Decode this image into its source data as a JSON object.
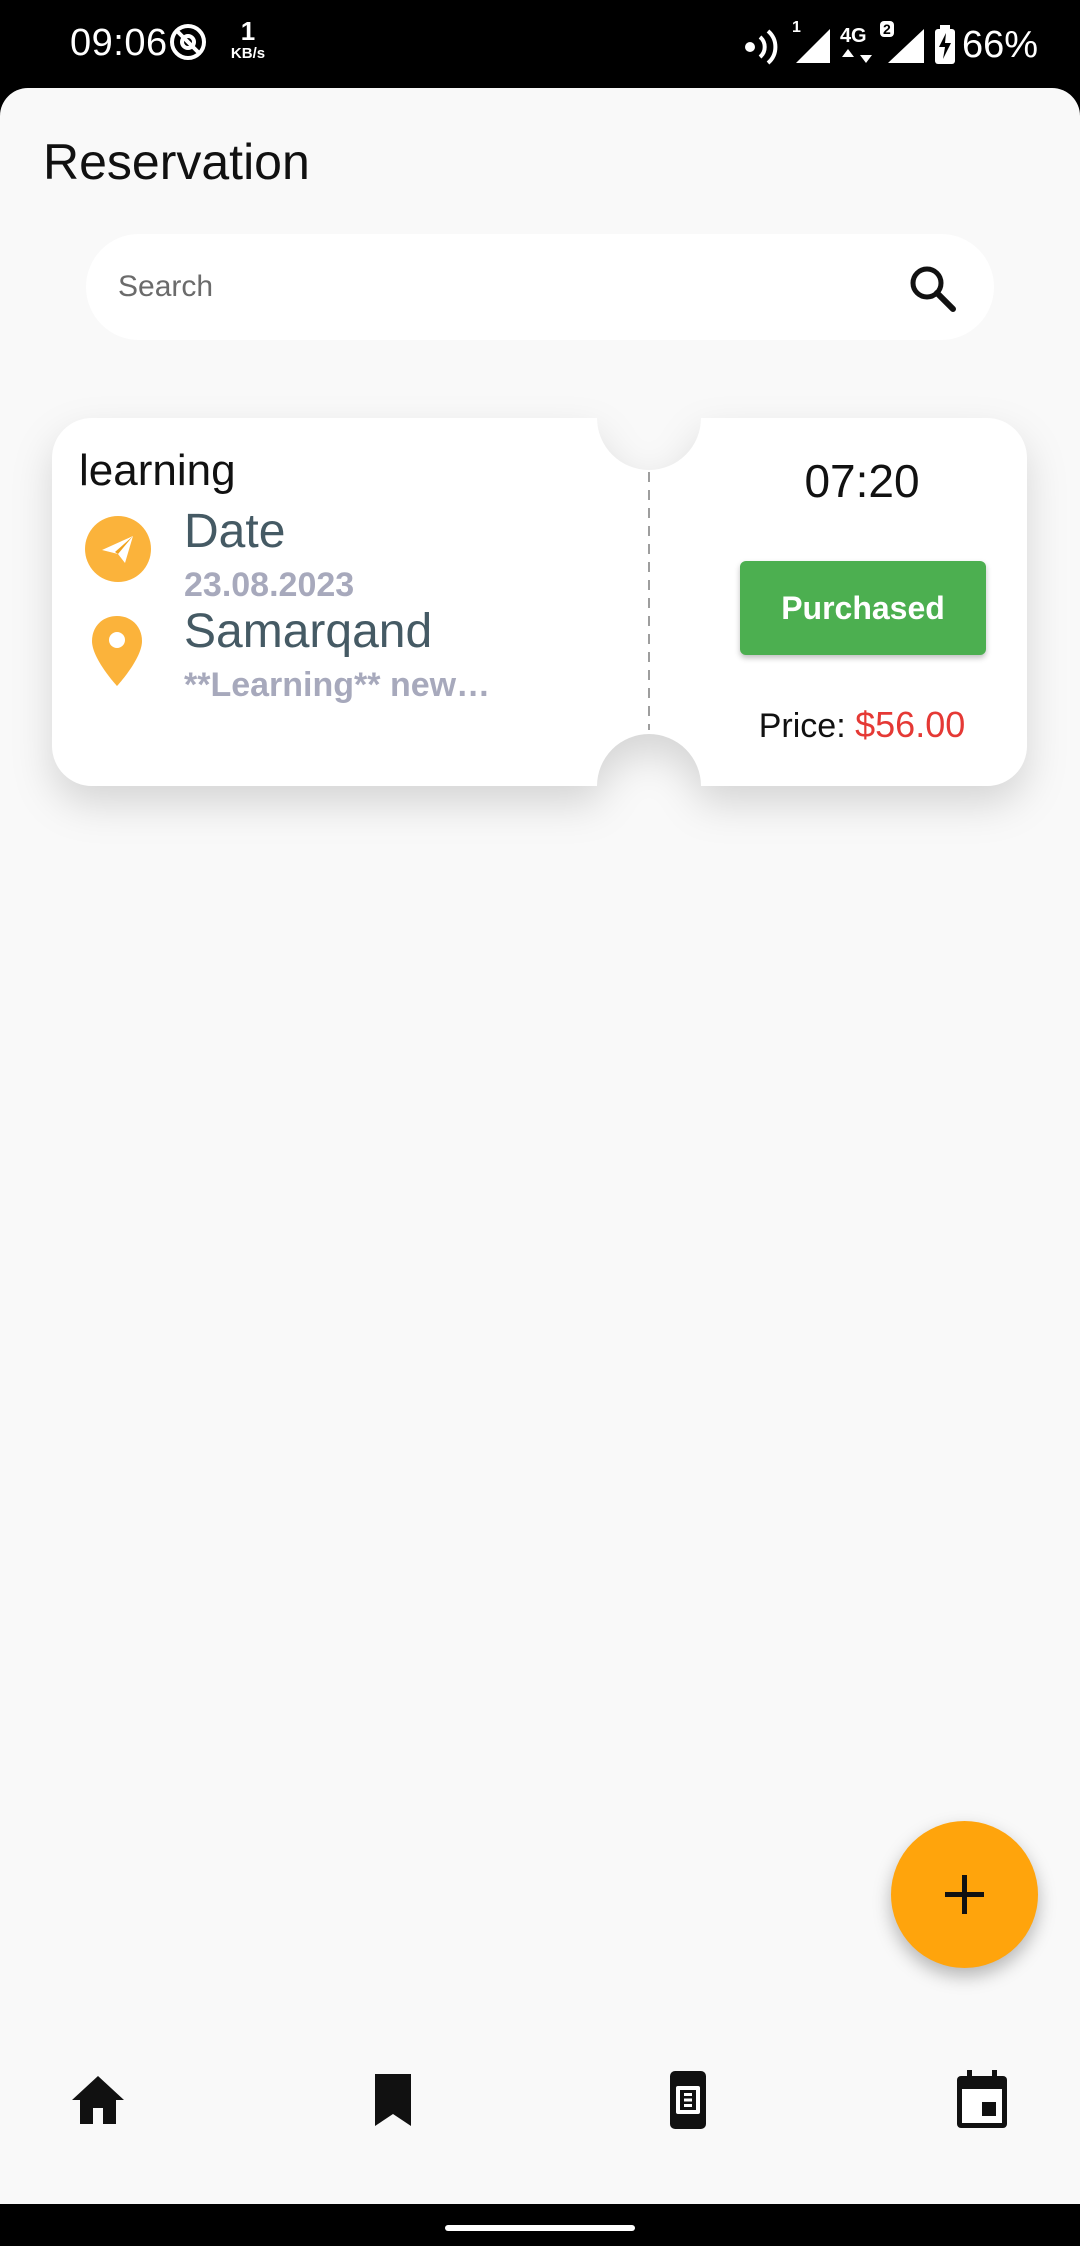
{
  "status_bar": {
    "time": "09:06",
    "net_speed_value": "1",
    "net_speed_unit": "KB/s",
    "network_type": "4G",
    "sim1_label": "1",
    "sim2_label": "2",
    "battery": "66%"
  },
  "header": {
    "title": "Reservation"
  },
  "search": {
    "placeholder": "Search",
    "value": ""
  },
  "ticket": {
    "title": "learning",
    "date_label": "Date",
    "date_value": "23.08.2023",
    "location": "Samarqand",
    "description": "**Learning** new…",
    "time": "07:20",
    "status_button": "Purchased",
    "price_label": "Price:",
    "price_value": "$56.00"
  },
  "colors": {
    "accent": "#ffa40c",
    "purchased": "#4caf50",
    "price": "#e53935",
    "icon_yellow": "#fbb33b"
  },
  "fab": {
    "icon": "plus-icon"
  },
  "bottom_nav": {
    "items": [
      "home-icon",
      "bookmark-icon",
      "ticket-icon",
      "calendar-icon"
    ]
  }
}
